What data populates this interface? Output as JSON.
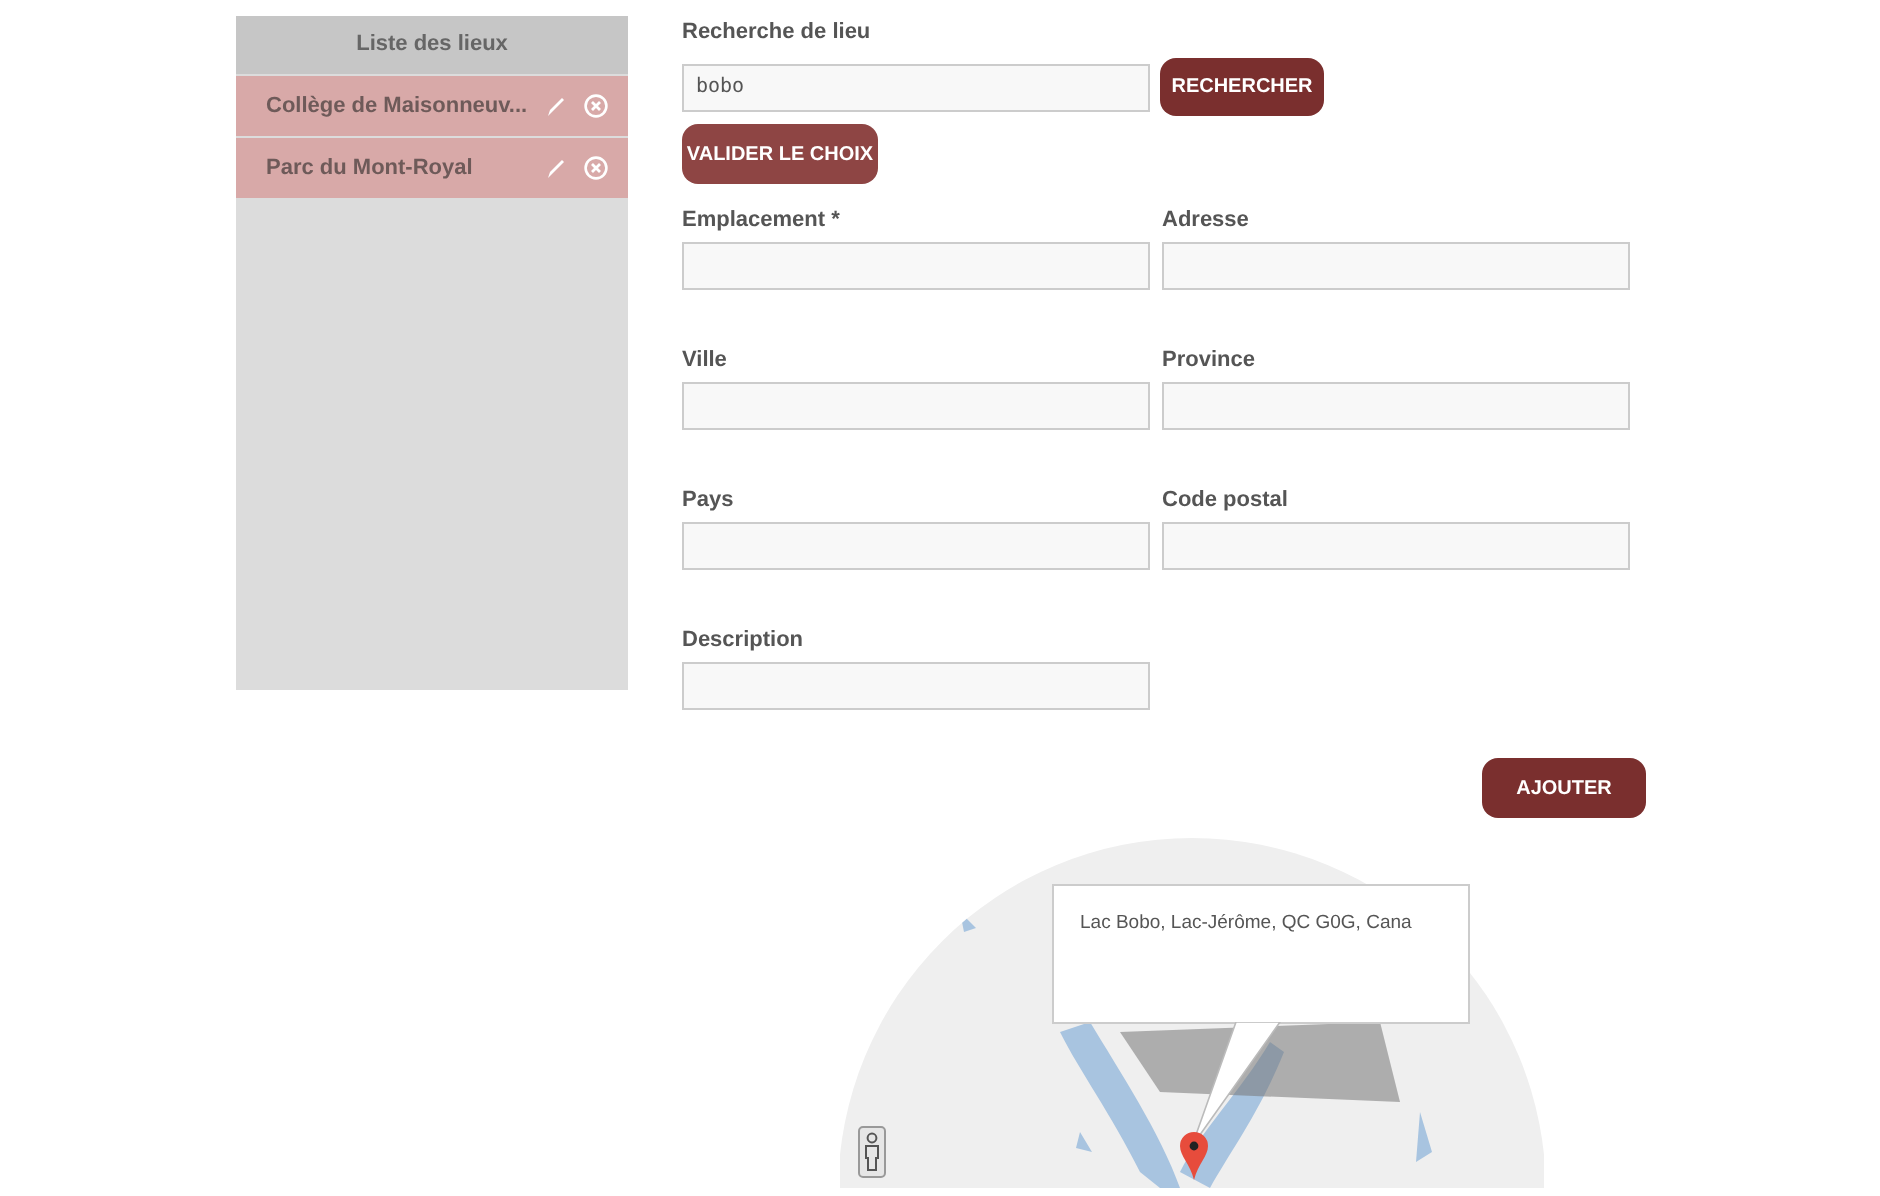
{
  "sidebar": {
    "title": "Liste des lieux",
    "items": [
      {
        "label": "Collège de Maisonneuv..."
      },
      {
        "label": "Parc du Mont-Royal"
      }
    ]
  },
  "search": {
    "label": "Recherche de lieu",
    "value": "bobo",
    "button": "RECHERCHER",
    "confirm_button": "VALIDER LE CHOIX"
  },
  "fields": [
    {
      "label": "Emplacement *"
    },
    {
      "label": "Adresse"
    },
    {
      "label": "Ville"
    },
    {
      "label": "Province"
    },
    {
      "label": "Pays"
    },
    {
      "label": "Code postal"
    },
    {
      "label": "Description"
    }
  ],
  "add_button": "AJOUTER",
  "map": {
    "info_text": "Lac Bobo, Lac-Jérôme, QC G0G, Cana"
  }
}
